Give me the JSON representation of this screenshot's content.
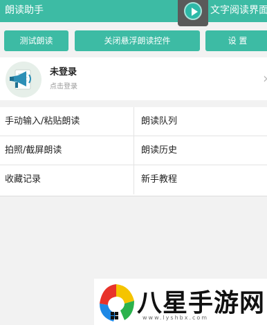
{
  "header": {
    "title": "朗读助手",
    "right_text": "文字阅读界面"
  },
  "toolbar": {
    "test_read": "测试朗读",
    "close_floating": "关闭悬浮朗读控件",
    "settings": "设 置"
  },
  "profile": {
    "username": "未登录",
    "hint": "点击登录",
    "chevron": "›"
  },
  "menu": {
    "items": [
      "手动输入/粘贴朗读",
      "朗读队列",
      "拍照/截屏朗读",
      "朗读历史",
      "收藏记录",
      "新手教程"
    ]
  },
  "watermark": {
    "text": "八星手游网",
    "url": "www.lyshbx.com"
  },
  "colors": {
    "accent": "#3dbba4"
  }
}
